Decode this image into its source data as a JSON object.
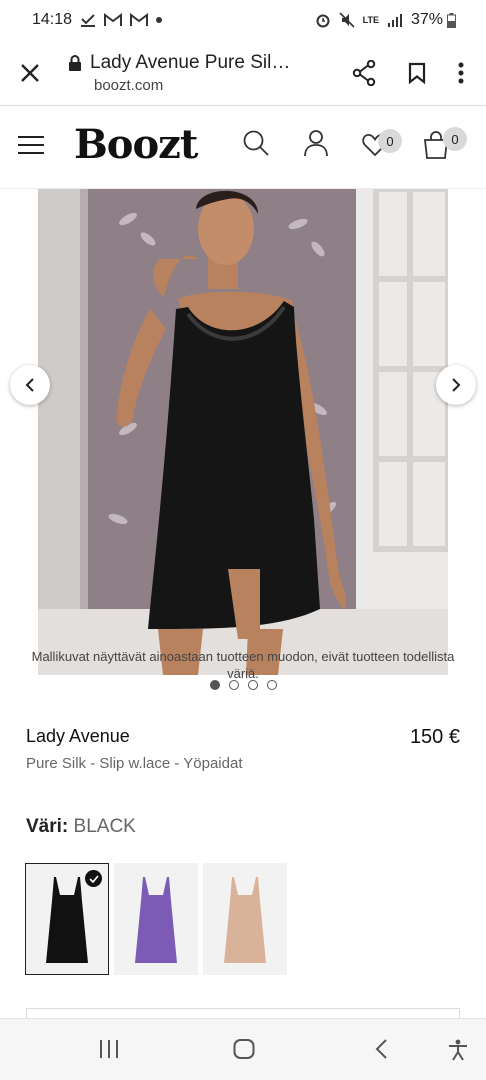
{
  "status_bar": {
    "time": "14:18",
    "battery": "37%",
    "network": "LTE"
  },
  "browser": {
    "page_title": "Lady Avenue Pure Sil…",
    "domain": "boozt.com"
  },
  "site_header": {
    "logo": "Boozt",
    "wishlist_count": "0",
    "cart_count": "0"
  },
  "gallery": {
    "disclaimer": "Mallikuvat näyttävät ainoastaan tuotteen muodon, eivät tuotteen todellista väriä.",
    "image_count": 4,
    "active_index": 0
  },
  "product": {
    "brand": "Lady Avenue",
    "price": "150 €",
    "subtitle": "Pure Silk - Slip w.lace - Yöpaidat",
    "color_label": "Väri:",
    "color_value": "BLACK",
    "swatches": [
      {
        "color": "#111111",
        "selected": true
      },
      {
        "color": "#7b5bb5",
        "selected": false
      },
      {
        "color": "#d8b39a",
        "selected": false
      }
    ]
  },
  "colors": {
    "wall": "#8f7f86",
    "window": "#e8e8e6",
    "dress": "#151515",
    "skin": "#b9825f"
  }
}
